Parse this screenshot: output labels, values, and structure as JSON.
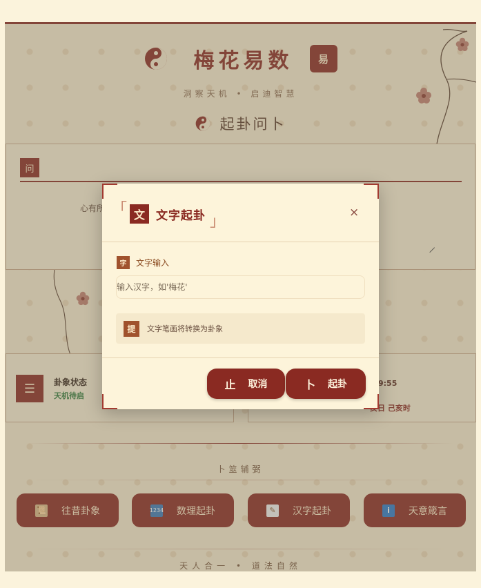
{
  "header": {
    "title": "梅花易数",
    "seal": "易",
    "subtitle": "洞察天机 • 启迪智慧"
  },
  "section": {
    "heading": "起卦问卜"
  },
  "question": {
    "badge": "问",
    "hint": "心有所"
  },
  "status": {
    "title": "卦象状态",
    "value": "天机待启",
    "time": "9:55",
    "shichen": "亥日 己亥时"
  },
  "tools": {
    "title": "卜筮辅弼",
    "buttons": [
      {
        "label": "往昔卦象",
        "icon": "scroll-icon"
      },
      {
        "label": "数理起卦",
        "icon": "numbers-icon"
      },
      {
        "label": "汉字起卦",
        "icon": "memo-icon"
      },
      {
        "label": "天意箴言",
        "icon": "info-icon"
      }
    ]
  },
  "footer": {
    "text": "天人合一 • 道法自然"
  },
  "modal": {
    "bracket_open": "「",
    "bracket_close": "」",
    "seal": "文",
    "title": "文字起卦",
    "close": "×",
    "field_seal": "字",
    "field_label": "文字输入",
    "input_placeholder": "输入汉字，如'梅花'",
    "input_value": "",
    "tip_seal": "提",
    "tip_text": "文字笔画将转换为卦象",
    "cancel_glyph": "止",
    "cancel_label": "取消",
    "confirm_glyph": "卜",
    "confirm_label": "起卦"
  },
  "colors": {
    "crimson": "#8a2a22",
    "parchment": "#fdf4da",
    "status_green": "#2f7a3a"
  }
}
